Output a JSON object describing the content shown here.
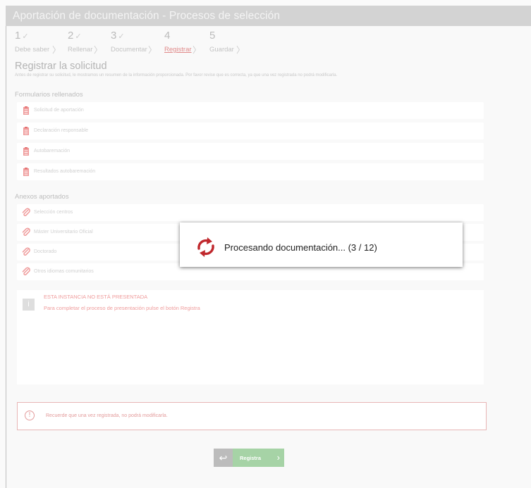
{
  "header": {
    "title": "Aportación de documentación - Procesos de selección"
  },
  "steps": [
    {
      "num": "1",
      "check": "✓",
      "label": "Debe saber"
    },
    {
      "num": "2",
      "check": "✓",
      "label": "Rellenar"
    },
    {
      "num": "3",
      "check": "✓",
      "label": "Documentar"
    },
    {
      "num": "4",
      "check": "",
      "label": "Registrar"
    },
    {
      "num": "5",
      "check": "",
      "label": "Guardar"
    }
  ],
  "page": {
    "heading": "Registrar la solicitud",
    "intro": "Antes de registrar su solicitud, le mostramos un resumen de la información proporcionada. Por favor revise que es correcta, ya que una vez registrada no podrá modificarla."
  },
  "forms": {
    "heading": "Formularios rellenados",
    "items": [
      "Solicitud de aportación",
      "Declaración responsable",
      "Autobaremación",
      "Resultados autobaremación"
    ]
  },
  "annexes": {
    "heading": "Anexos aportados",
    "items": [
      "Selección centros",
      "Máster Universitario Oficial",
      "Doctorado",
      "Otros idiomas comunitarios"
    ]
  },
  "info": {
    "icon": "i",
    "line1": "ESTA INSTANCIA NO ESTÁ PRESENTADA",
    "line2": "Para completar el proceso de presentación pulse el botón Registra"
  },
  "warning": {
    "icon": "!",
    "text": "Recuerde que una vez registrada, no podrá modificarla."
  },
  "buttons": {
    "back": "↩",
    "register": "Registra",
    "register_chevron": "›"
  },
  "modal": {
    "text": "Procesando documentación... (3 / 12)"
  },
  "colors": {
    "accent_red": "#c0282d",
    "register_green": "#a6d3a6",
    "titlebar": "#d3d3d3"
  }
}
